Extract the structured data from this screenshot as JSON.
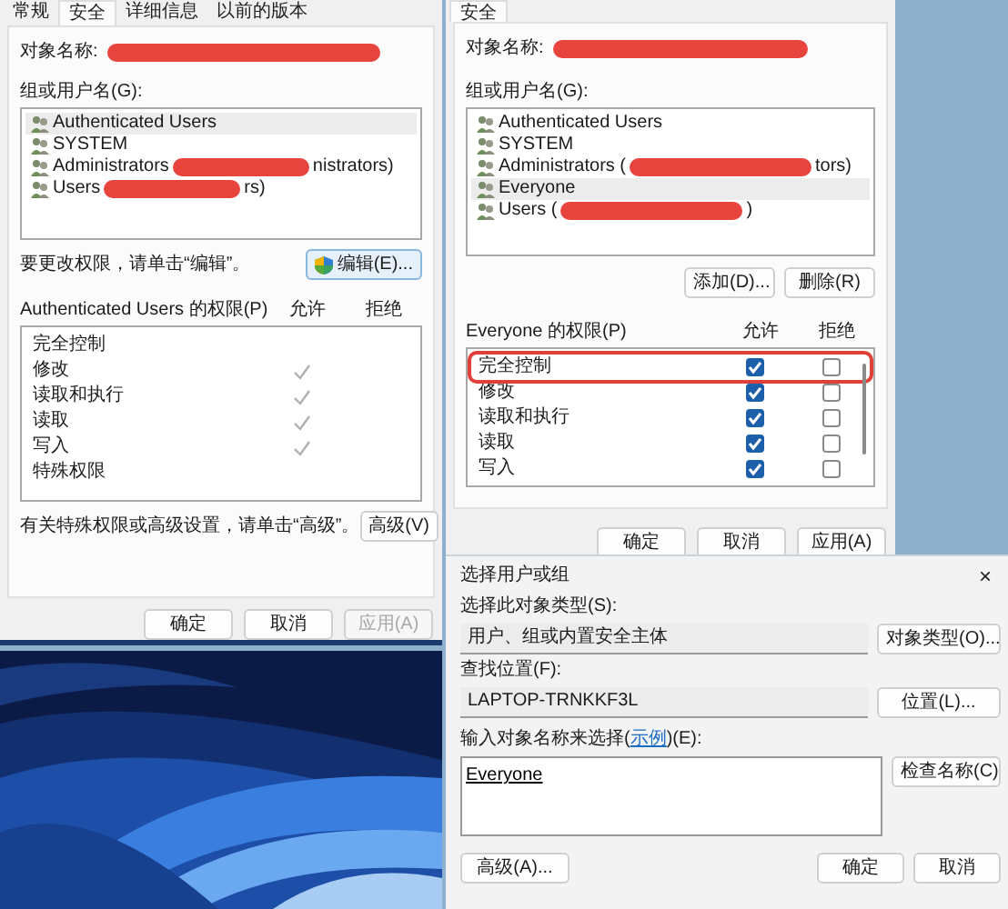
{
  "left_dialog": {
    "tabs": [
      {
        "label": "常规",
        "selected": false
      },
      {
        "label": "安全",
        "selected": true
      },
      {
        "label": "详细信息",
        "selected": false
      },
      {
        "label": "以前的版本",
        "selected": false
      }
    ],
    "object_label": "对象名称:",
    "object_redacted": true,
    "groups_label": "组或用户名(G):",
    "principals": [
      {
        "name": "Authenticated Users",
        "selected": true,
        "redacted": false
      },
      {
        "name": "SYSTEM",
        "selected": false,
        "redacted": false
      },
      {
        "name": "Administrators",
        "selected": false,
        "redacted": true,
        "tail": "nistrators)"
      },
      {
        "name": "Users",
        "selected": false,
        "redacted": true,
        "tail": "rs)"
      }
    ],
    "edit_hint": "要更改权限，请单击“编辑”。",
    "edit_button": "编辑(E)...",
    "permissions_label": "Authenticated Users 的权限(P)",
    "allow_label": "允许",
    "deny_label": "拒绝",
    "permissions": [
      {
        "name": "完全控制",
        "allow": false
      },
      {
        "name": "修改",
        "allow": true
      },
      {
        "name": "读取和执行",
        "allow": true
      },
      {
        "name": "读取",
        "allow": true
      },
      {
        "name": "写入",
        "allow": true
      },
      {
        "name": "特殊权限",
        "allow": false
      }
    ],
    "advanced_hint": "有关特殊权限或高级设置，请单击“高级”。",
    "advanced_button": "高级(V)",
    "buttons": [
      {
        "label": "确定",
        "disabled": false
      },
      {
        "label": "取消",
        "disabled": false
      },
      {
        "label": "应用(A)",
        "disabled": true
      }
    ]
  },
  "right_dialog": {
    "tabs": [
      {
        "label": "安全",
        "selected": true
      }
    ],
    "object_label": "对象名称:",
    "object_redacted": true,
    "groups_label": "组或用户名(G):",
    "principals": [
      {
        "name": "Authenticated Users",
        "selected": false,
        "redacted": false
      },
      {
        "name": "SYSTEM",
        "selected": false,
        "redacted": false
      },
      {
        "name": "Administrators (",
        "selected": false,
        "redacted": true,
        "tail": "tors)"
      },
      {
        "name": "Everyone",
        "selected": true,
        "redacted": false
      },
      {
        "name": "Users (",
        "selected": false,
        "redacted": true,
        "tail": ")"
      }
    ],
    "add_button": "添加(D)...",
    "remove_button": "删除(R)",
    "permissions_label": "Everyone 的权限(P)",
    "allow_label": "允许",
    "deny_label": "拒绝",
    "permissions": [
      {
        "name": "完全控制",
        "allow": true,
        "deny": false,
        "highlighted": true
      },
      {
        "name": "修改",
        "allow": true,
        "deny": false,
        "highlighted": false
      },
      {
        "name": "读取和执行",
        "allow": true,
        "deny": false,
        "highlighted": false
      },
      {
        "name": "读取",
        "allow": true,
        "deny": false,
        "highlighted": false
      },
      {
        "name": "写入",
        "allow": true,
        "deny": false,
        "highlighted": false
      }
    ],
    "buttons": [
      {
        "label": "确定",
        "disabled": false
      },
      {
        "label": "取消",
        "disabled": false
      },
      {
        "label": "应用(A)",
        "disabled": false
      }
    ]
  },
  "select_dialog": {
    "title": "选择用户或组",
    "close": "×",
    "object_type_label": "选择此对象类型(S):",
    "object_type": "用户、组或内置安全主体",
    "object_type_button": "对象类型(O)...",
    "location_label": "查找位置(F):",
    "location": "LAPTOP-TRNKKF3L",
    "location_button": "位置(L)...",
    "names_label": {
      "before": "输入对象名称来选择(",
      "link": "示例",
      "after": ")(E):"
    },
    "names_value": "Everyone",
    "check_button": "检查名称(C)",
    "advanced_button": "高级(A)...",
    "buttons": [
      {
        "label": "确定"
      },
      {
        "label": "取消"
      }
    ]
  }
}
